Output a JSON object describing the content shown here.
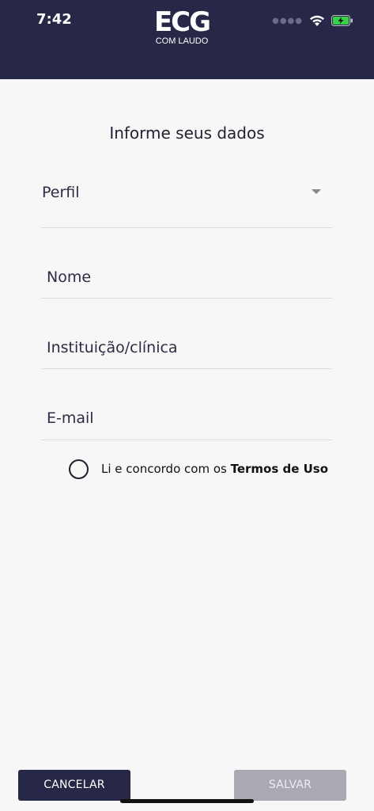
{
  "status_bar": {
    "time": "7:42",
    "icons": [
      "signal-dots-icon",
      "wifi-icon",
      "battery-charging-icon"
    ],
    "battery_color": "#35d14b"
  },
  "header": {
    "logo_main": "ECG",
    "logo_sub": "COM LAUDO",
    "background_color": "#272748"
  },
  "form": {
    "title": "Informe seus dados",
    "profile_label": "Perfil",
    "name_label": "Nome",
    "institution_label": "Instituição/clínica",
    "email_label": "E-mail",
    "terms_prefix": "Li e concordo com os ",
    "terms_link": "Termos de Uso"
  },
  "buttons": {
    "cancel_label": "CANCELAR",
    "save_label": "SALVAR"
  }
}
